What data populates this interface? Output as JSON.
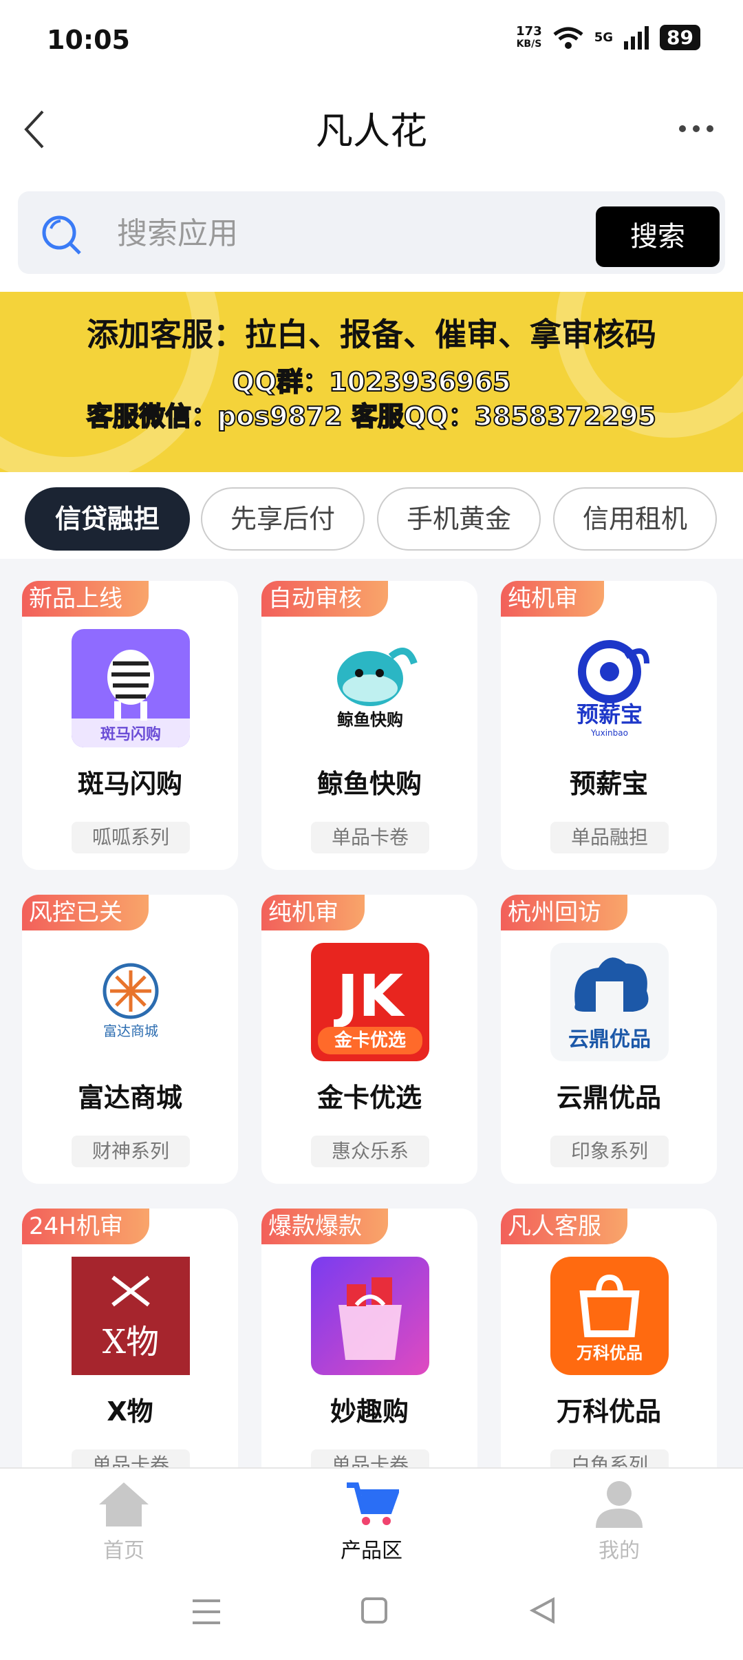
{
  "status": {
    "time": "10:05",
    "speed_value": "173",
    "speed_unit": "KB/S",
    "network": "5G",
    "battery": "89"
  },
  "header": {
    "title": "凡人花"
  },
  "search": {
    "placeholder": "搜索应用",
    "button": "搜索"
  },
  "banner": {
    "line1": "添加客服：拉白、报备、催审、拿审核码",
    "line2": "QQ群：1023936965",
    "line3": "客服微信：pos9872  客服QQ：3858372295"
  },
  "tabs": [
    "信贷融担",
    "先享后付",
    "手机黄金",
    "信用租机"
  ],
  "active_tab": "信贷融担",
  "products": [
    {
      "badge": "新品上线",
      "name": "斑马闪购",
      "tag": "呱呱系列",
      "logo_text": "斑马闪购",
      "logo_icon": "zebra-icon"
    },
    {
      "badge": "自动审核",
      "name": "鲸鱼快购",
      "tag": "单品卡卷",
      "logo_text": "鲸鱼快购",
      "logo_icon": "whale-icon"
    },
    {
      "badge": "纯机审",
      "name": "预薪宝",
      "tag": "单品融担",
      "logo_text": "预薪宝",
      "logo_subtext": "Yuxinbao",
      "logo_icon": "g-swirl-icon"
    },
    {
      "badge": "风控已关",
      "name": "富达商城",
      "tag": "财神系列",
      "logo_text": "富达商城",
      "logo_icon": "sunburst-icon"
    },
    {
      "badge": "纯机审",
      "name": "金卡优选",
      "tag": "惠众乐系",
      "logo_text": "金卡优选",
      "logo_mark": "JK",
      "logo_icon": "jk-icon"
    },
    {
      "badge": "杭州回访",
      "name": "云鼎优品",
      "tag": "印象系列",
      "logo_text": "云鼎优品",
      "logo_icon": "cloud-ding-icon"
    },
    {
      "badge": "24H机审",
      "name": "X物",
      "tag": "单品卡卷",
      "logo_text": "X物",
      "logo_icon": "x-wu-icon"
    },
    {
      "badge": "爆款爆款",
      "name": "妙趣购",
      "tag": "单品卡卷",
      "logo_icon": "shopping-bag-icon"
    },
    {
      "badge": "凡人客服",
      "name": "万科优品",
      "tag": "白鱼系列",
      "logo_text": "万科优品",
      "logo_icon": "bag-icon"
    }
  ],
  "bottom_nav": [
    {
      "label": "首页",
      "icon": "home-icon",
      "active": false
    },
    {
      "label": "产品区",
      "icon": "cart-icon",
      "active": true
    },
    {
      "label": "我的",
      "icon": "user-icon",
      "active": false
    }
  ]
}
